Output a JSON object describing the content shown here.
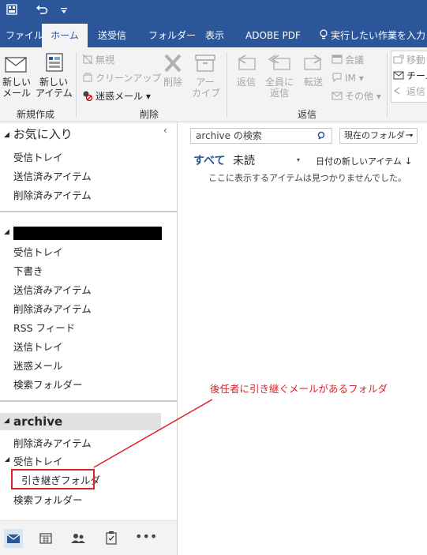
{
  "qat": {
    "icons": [
      "outlook-layout-icon",
      "undo-icon",
      "customize-qat-icon"
    ]
  },
  "tabs": [
    "ファイル",
    "ホーム",
    "送受信",
    "フォルダー",
    "表示",
    "ADOBE PDF"
  ],
  "tell_me": "実行したい作業を入力し",
  "ribbon": {
    "new_mail": "新しい\nメール",
    "new_items": "新しい\nアイテム",
    "new_group": "新規作成",
    "ignore": "無視",
    "cleanup": "クリーンアップ",
    "junk": "迷惑メール",
    "delete": "削除",
    "archive": "アー\nカイブ",
    "delete_group": "削除",
    "reply": "返信",
    "reply_all": "全員に\n返信",
    "forward": "転送",
    "meeting": "会議",
    "im": "IM",
    "more": "その他",
    "respond_group": "返信",
    "move_to": "移動",
    "team": "チーム",
    "reply_delete": "返信"
  },
  "nav": {
    "favorites_title": "お気に入り",
    "favorites": [
      "受信トレイ",
      "送信済みアイテム",
      "削除済みアイテム"
    ],
    "account_folders": [
      "受信トレイ",
      "下書き",
      "送信済みアイテム",
      "削除済みアイテム",
      "RSS フィード",
      "送信トレイ",
      "迷惑メール",
      "検索フォルダー"
    ],
    "archive_title": "archive",
    "archive_folders": {
      "deleted": "削除済みアイテム",
      "inbox": "受信トレイ",
      "handover": "引き継ぎフォルダ",
      "search": "検索フォルダー"
    }
  },
  "bottom_nav": [
    "mail-icon",
    "calendar-icon",
    "people-icon",
    "tasks-icon",
    "more-icon"
  ],
  "main": {
    "search_placeholder": "archive の検索",
    "scope": "現在のフォルダー",
    "filter_all": "すべて",
    "filter_unread": "未読",
    "sort": "日付の新しいアイテム",
    "empty_message": "ここに表示するアイテムは見つかりませんでした。"
  },
  "annotation": {
    "text": "後任者に引き継ぐメールがあるフォルダ",
    "color": "#d9262c"
  },
  "colors": {
    "accent": "#2b579a",
    "ribbon_bg": "#f3f3f3"
  }
}
